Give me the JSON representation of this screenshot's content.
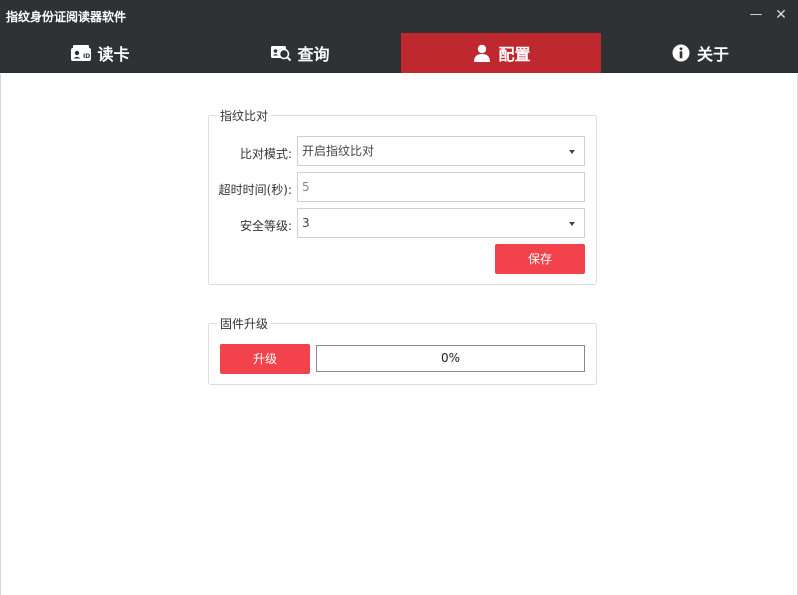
{
  "window": {
    "title": "指纹身份证阅读器软件",
    "minimize_glyph": "—",
    "close_glyph": "✕"
  },
  "nav": {
    "tabs": [
      {
        "label": "读卡",
        "icon": "id-card-icon"
      },
      {
        "label": "查询",
        "icon": "search-card-icon"
      },
      {
        "label": "配置",
        "icon": "user-icon",
        "active": true
      },
      {
        "label": "关于",
        "icon": "info-icon"
      }
    ],
    "active_color": "#c0282f",
    "bar_color": "#2f3235"
  },
  "fingerprint": {
    "group_title": "指纹比对",
    "mode_label": "比对模式:",
    "mode_value": "开启指纹比对",
    "timeout_label": "超时时间(秒):",
    "timeout_value": "5",
    "security_label": "安全等级:",
    "security_value": "3",
    "save_label": "保存"
  },
  "firmware": {
    "group_title": "固件升级",
    "upgrade_label": "升级",
    "progress_text": "0%",
    "progress_fraction": 0
  },
  "colors": {
    "accent": "#f2434c"
  }
}
